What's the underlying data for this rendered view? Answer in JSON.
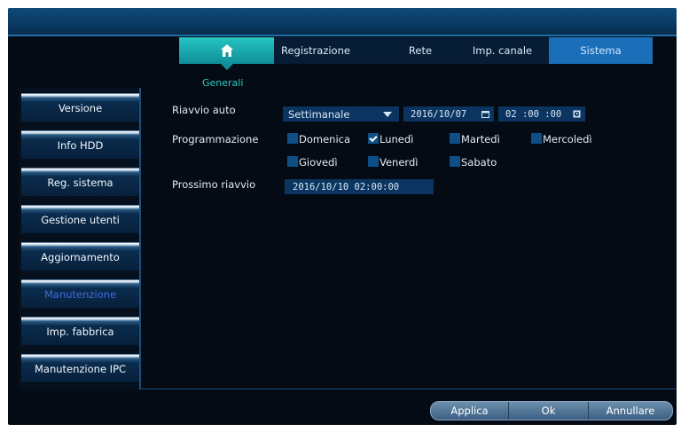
{
  "tabs": [
    {
      "label": ""
    },
    {
      "label": "Registrazione"
    },
    {
      "label": "Rete"
    },
    {
      "label": "Imp. canale"
    },
    {
      "label": "Sistema"
    }
  ],
  "home_icon": "home-icon",
  "section_title": "Generali",
  "sidebar": {
    "items": [
      {
        "label": "Versione"
      },
      {
        "label": "Info HDD"
      },
      {
        "label": "Reg. sistema"
      },
      {
        "label": "Gestione utenti"
      },
      {
        "label": "Aggiornamento"
      },
      {
        "label": "Manutenzione"
      },
      {
        "label": "Imp. fabbrica"
      },
      {
        "label": "Manutenzione IPC"
      }
    ],
    "active": "Manutenzione"
  },
  "form": {
    "riavvio_label": "Riavvio auto",
    "riavvio_value": "Settimanale",
    "date_value": "2016/10/07",
    "time_value": "02 :00 :00",
    "programmazione_label": "Programmazione",
    "days": [
      {
        "label": "Domenica",
        "checked": false
      },
      {
        "label": "Lunedì",
        "checked": true
      },
      {
        "label": "Martedì",
        "checked": false
      },
      {
        "label": "Mercoledì",
        "checked": false
      },
      {
        "label": "Giovedì",
        "checked": false
      },
      {
        "label": "Venerdì",
        "checked": false
      },
      {
        "label": "Sabato",
        "checked": false
      }
    ],
    "prossimo_label": "Prossimo riavvio",
    "prossimo_value": "2016/10/10 02:00:00"
  },
  "buttons": {
    "apply": "Applica",
    "ok": "Ok",
    "cancel": "Annullare"
  },
  "colors": {
    "accent_teal": "#25c4c2",
    "tab_active": "#1a6fb8",
    "active_sidebar_text": "#3f6be0",
    "background": "#050b14"
  }
}
